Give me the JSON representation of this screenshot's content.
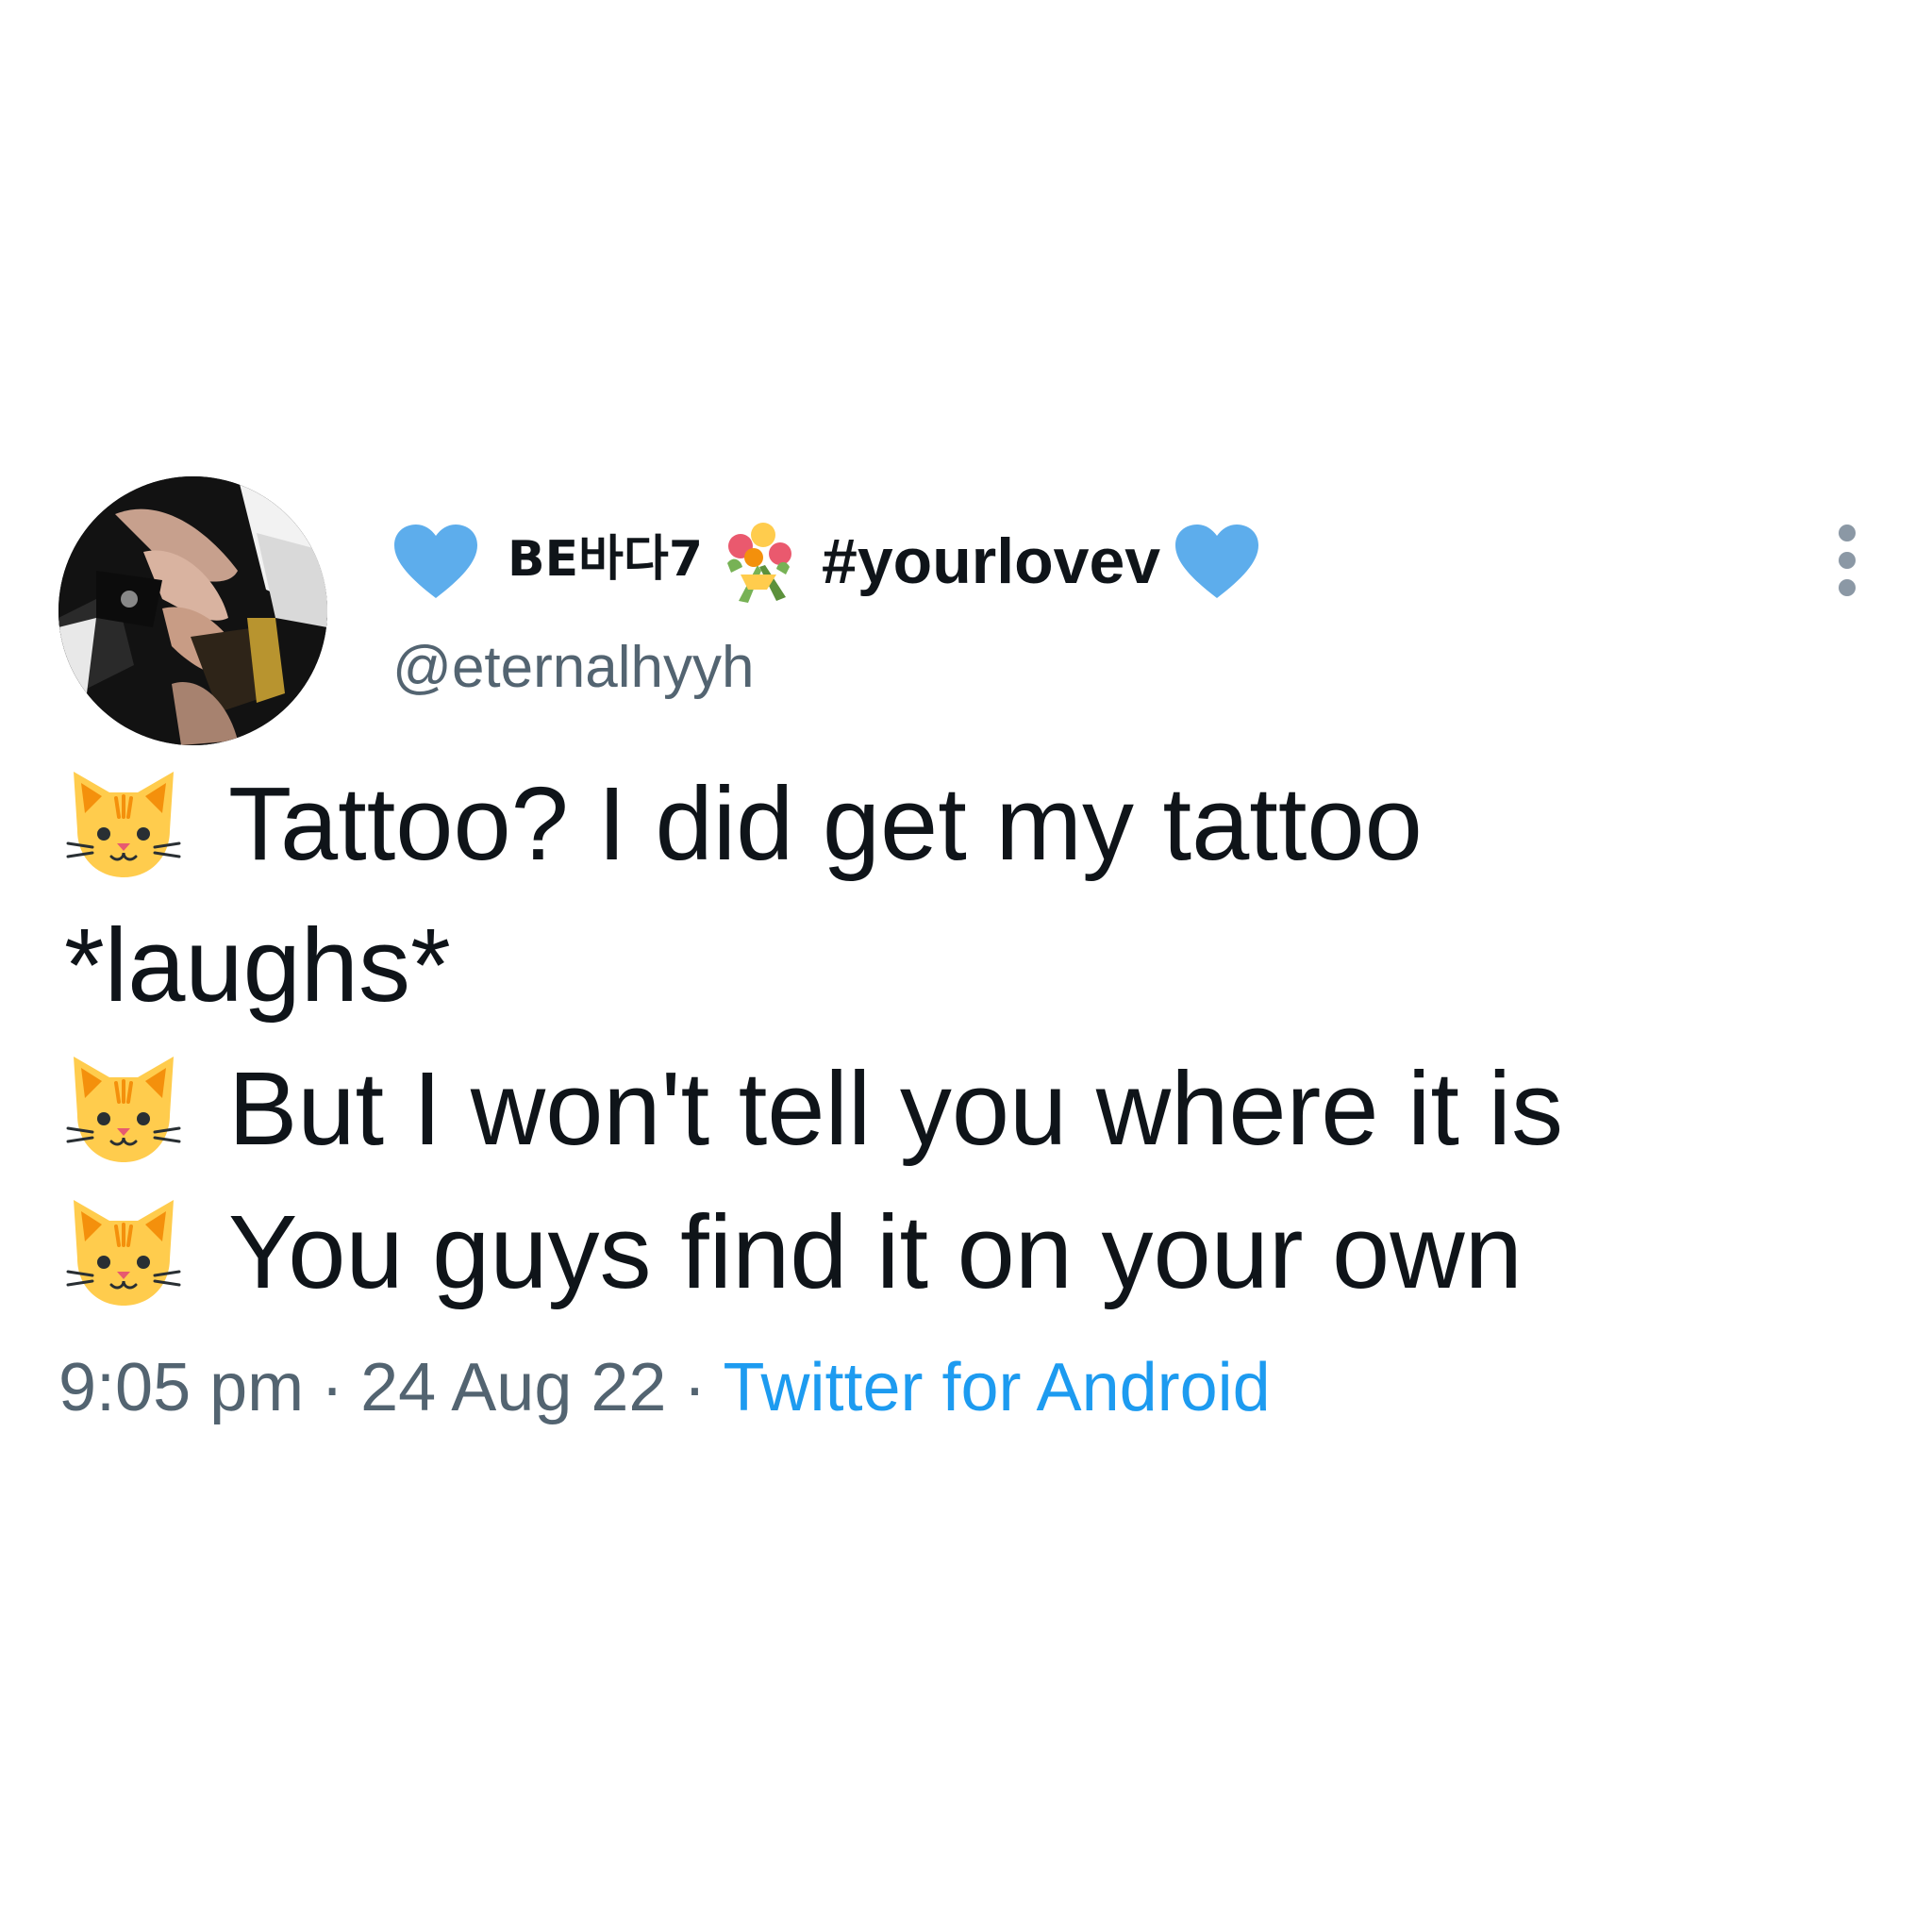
{
  "tweet": {
    "display_name": {
      "prefix": "BE바다7",
      "hashtag": "#yourlovev"
    },
    "handle": "@eternalhyyh",
    "body": {
      "line1": "Tattoo? I did get my tattoo",
      "line2": "*laughs*",
      "line3": "But I won't tell you where it is",
      "line4": "You guys find it on your own"
    },
    "meta": {
      "time": "9:05 pm",
      "separator": "·",
      "date": "24 Aug 22",
      "source": "Twitter for Android"
    },
    "icons": {
      "name_heart": "blue-heart-icon",
      "bouquet": "bouquet-icon",
      "cat": "cat-face-icon",
      "more": "more-options-icon"
    },
    "colors": {
      "text": "#0f1419",
      "secondary": "#536471",
      "link": "#1d9bf0",
      "heart": "#5dadec"
    }
  }
}
